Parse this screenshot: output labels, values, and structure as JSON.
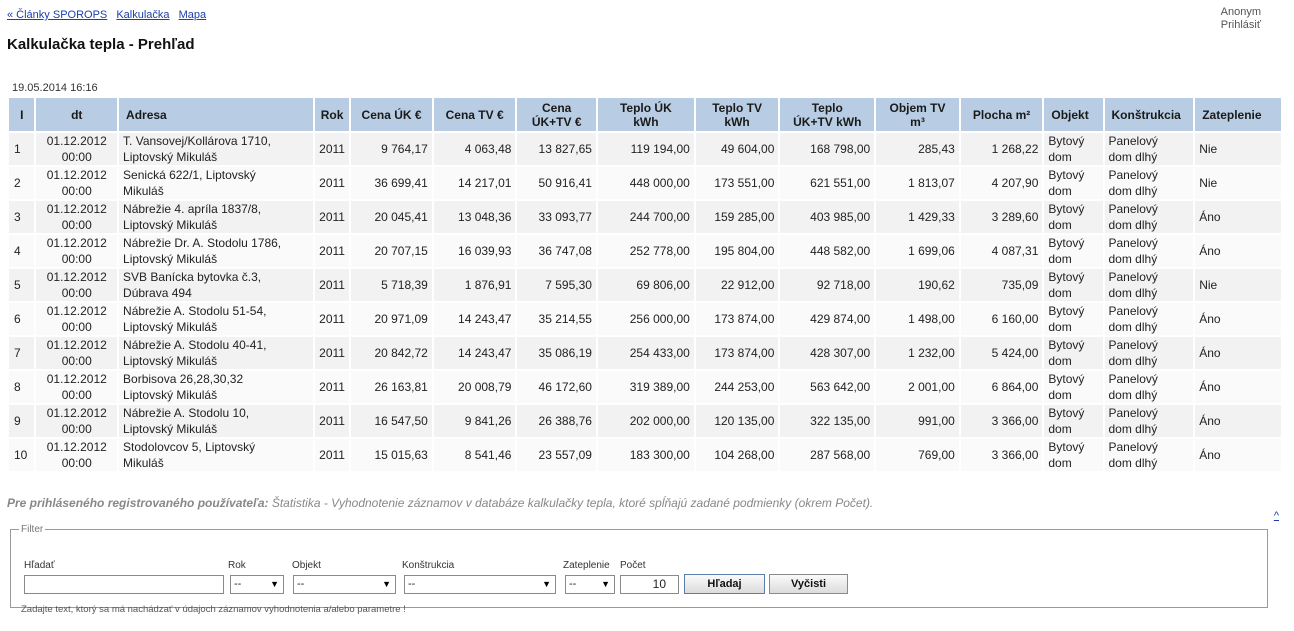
{
  "nav": {
    "links": [
      "« Články SPOROPS",
      "Kalkulačka",
      "Mapa"
    ]
  },
  "user": {
    "name": "Anonym",
    "login": "Prihlásiť"
  },
  "page": {
    "title": "Kalkulačka tepla - Prehľad",
    "timestamp": "19.05.2014 16:16"
  },
  "table": {
    "headers": [
      "I",
      "dt",
      "Adresa",
      "Rok",
      "Cena ÚK €",
      "Cena TV €",
      "Cena\nÚK+TV €",
      "Teplo ÚK\nkWh",
      "Teplo TV\nkWh",
      "Teplo\nÚK+TV kWh",
      "Objem TV\nm³",
      "Plocha m²",
      "Objekt",
      "Konštrukcia",
      "Zateplenie"
    ],
    "rows": [
      [
        "1",
        "01.12.2012\n00:00",
        "T. Vansovej/Kollárova 1710,\nLiptovský Mikuláš",
        "2011",
        "9 764,17",
        "4 063,48",
        "13 827,65",
        "119 194,00",
        "49 604,00",
        "168 798,00",
        "285,43",
        "1 268,22",
        "Bytový\ndom",
        "Panelový\ndom dlhý",
        "Nie"
      ],
      [
        "2",
        "01.12.2012\n00:00",
        "Senická 622/1, Liptovský\nMikuláš",
        "2011",
        "36 699,41",
        "14 217,01",
        "50 916,41",
        "448 000,00",
        "173 551,00",
        "621 551,00",
        "1 813,07",
        "4 207,90",
        "Bytový\ndom",
        "Panelový\ndom dlhý",
        "Nie"
      ],
      [
        "3",
        "01.12.2012\n00:00",
        "Nábrežie 4. apríla 1837/8,\nLiptovský Mikuláš",
        "2011",
        "20 045,41",
        "13 048,36",
        "33 093,77",
        "244 700,00",
        "159 285,00",
        "403 985,00",
        "1 429,33",
        "3 289,60",
        "Bytový\ndom",
        "Panelový\ndom dlhý",
        "Áno"
      ],
      [
        "4",
        "01.12.2012\n00:00",
        "Nábrežie Dr. A. Stodolu 1786,\nLiptovský Mikuláš",
        "2011",
        "20 707,15",
        "16 039,93",
        "36 747,08",
        "252 778,00",
        "195 804,00",
        "448 582,00",
        "1 699,06",
        "4 087,31",
        "Bytový\ndom",
        "Panelový\ndom dlhý",
        "Áno"
      ],
      [
        "5",
        "01.12.2012\n00:00",
        "SVB Banícka bytovka č.3,\nDúbrava 494",
        "2011",
        "5 718,39",
        "1 876,91",
        "7 595,30",
        "69 806,00",
        "22 912,00",
        "92 718,00",
        "190,62",
        "735,09",
        "Bytový\ndom",
        "Panelový\ndom dlhý",
        "Nie"
      ],
      [
        "6",
        "01.12.2012\n00:00",
        "Nábrežie A. Stodolu 51-54,\nLiptovský Mikuláš",
        "2011",
        "20 971,09",
        "14 243,47",
        "35 214,55",
        "256 000,00",
        "173 874,00",
        "429 874,00",
        "1 498,00",
        "6 160,00",
        "Bytový\ndom",
        "Panelový\ndom dlhý",
        "Áno"
      ],
      [
        "7",
        "01.12.2012\n00:00",
        "Nábrežie A. Stodolu 40-41,\nLiptovský Mikuláš",
        "2011",
        "20 842,72",
        "14 243,47",
        "35 086,19",
        "254 433,00",
        "173 874,00",
        "428 307,00",
        "1 232,00",
        "5 424,00",
        "Bytový\ndom",
        "Panelový\ndom dlhý",
        "Áno"
      ],
      [
        "8",
        "01.12.2012\n00:00",
        "Borbisova 26,28,30,32\nLiptovský Mikuláš",
        "2011",
        "26 163,81",
        "20 008,79",
        "46 172,60",
        "319 389,00",
        "244 253,00",
        "563 642,00",
        "2 001,00",
        "6 864,00",
        "Bytový\ndom",
        "Panelový\ndom dlhý",
        "Áno"
      ],
      [
        "9",
        "01.12.2012\n00:00",
        "Nábrežie A. Stodolu 10,\nLiptovský Mikuláš",
        "2011",
        "16 547,50",
        "9 841,26",
        "26 388,76",
        "202 000,00",
        "120 135,00",
        "322 135,00",
        "991,00",
        "3 366,00",
        "Bytový\ndom",
        "Panelový\ndom dlhý",
        "Áno"
      ],
      [
        "10",
        "01.12.2012\n00:00",
        "Stodolovcov 5, Liptovský\nMikuláš",
        "2011",
        "15 015,63",
        "8 541,46",
        "23 557,09",
        "183 300,00",
        "104 268,00",
        "287 568,00",
        "769,00",
        "3 366,00",
        "Bytový\ndom",
        "Panelový\ndom dlhý",
        "Áno"
      ]
    ]
  },
  "note": {
    "bold": "Pre prihláseného registrovaného používateľa:",
    "text": " Štatistika - Vyhodnotenie záznamov v databáze kalkulačky tepla, ktoré spĺňajú zadané podmienky (okrem Počet)."
  },
  "top_link": "^",
  "filter": {
    "legend": "Filter",
    "search_label": "Hľadať",
    "search_value": "",
    "rok_label": "Rok",
    "rok_value": "--",
    "objekt_label": "Objekt",
    "objekt_value": "--",
    "konstrukcia_label": "Konštrukcia",
    "konstrukcia_value": "--",
    "zateplenie_label": "Zateplenie",
    "zateplenie_value": "--",
    "pocet_label": "Počet",
    "pocet_value": "10",
    "search_button": "Hľadaj",
    "clear_button": "Vyčisti",
    "hint": "Zadajte text, ktorý sa má nachádzať v údajoch záznamov vyhodnotenia a/alebo parametre !"
  }
}
